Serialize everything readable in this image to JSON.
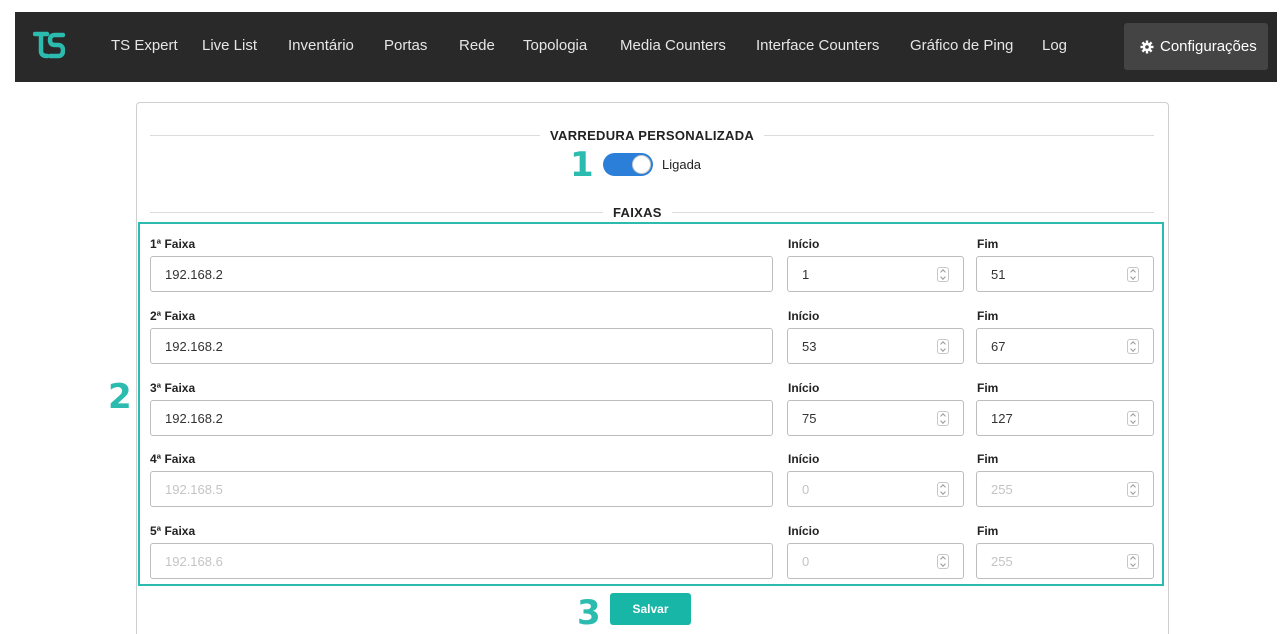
{
  "nav": {
    "items": [
      "TS Expert",
      "Live List",
      "Inventário",
      "Portas",
      "Rede",
      "Topologia",
      "Media Counters",
      "Interface Counters",
      "Gráfico de Ping",
      "Log"
    ],
    "config_label": "Configurações",
    "logo_icon": "ts-logo-icon",
    "config_icon": "gear-icon"
  },
  "varredura": {
    "title": "VARREDURA PERSONALIZADA",
    "toggle_state": true,
    "toggle_label": "Ligada"
  },
  "faixas": {
    "title": "FAIXAS",
    "inicio_label": "Início",
    "fim_label": "Fim",
    "rows": [
      {
        "label": "1ª Faixa",
        "ip": "192.168.2",
        "inicio": "1",
        "fim": "51",
        "placeholder": false
      },
      {
        "label": "2ª Faixa",
        "ip": "192.168.2",
        "inicio": "53",
        "fim": "67",
        "placeholder": false
      },
      {
        "label": "3ª Faixa",
        "ip": "192.168.2",
        "inicio": "75",
        "fim": "127",
        "placeholder": false
      },
      {
        "label": "4ª Faixa",
        "ip": "192.168.5",
        "inicio": "0",
        "fim": "255",
        "placeholder": true
      },
      {
        "label": "5ª Faixa",
        "ip": "192.168.6",
        "inicio": "0",
        "fim": "255",
        "placeholder": true
      }
    ]
  },
  "annotations": [
    "1",
    "2",
    "3"
  ],
  "save_label": "Salvar",
  "colors": {
    "navbar": "#292929",
    "accent": "#2bbcaf",
    "toggle": "#2b7fd9",
    "save_button": "#18b6a6"
  }
}
